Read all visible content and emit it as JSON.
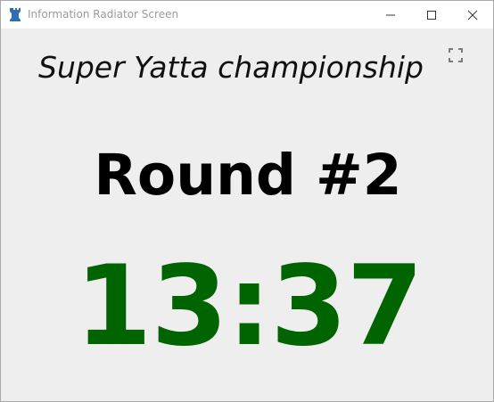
{
  "window": {
    "title": "Information Radiator Screen",
    "icon": "rook-icon",
    "controls": [
      "minimize-icon",
      "maximize-icon",
      "close-icon"
    ]
  },
  "screen": {
    "event_title": "Super Yatta championship",
    "round_label": "Round #2",
    "timer": "13:37",
    "fullscreen_icon": "fullscreen-icon"
  },
  "colors": {
    "timer": "#006400",
    "background": "#eeeeee",
    "titlebar": "#ffffff"
  }
}
